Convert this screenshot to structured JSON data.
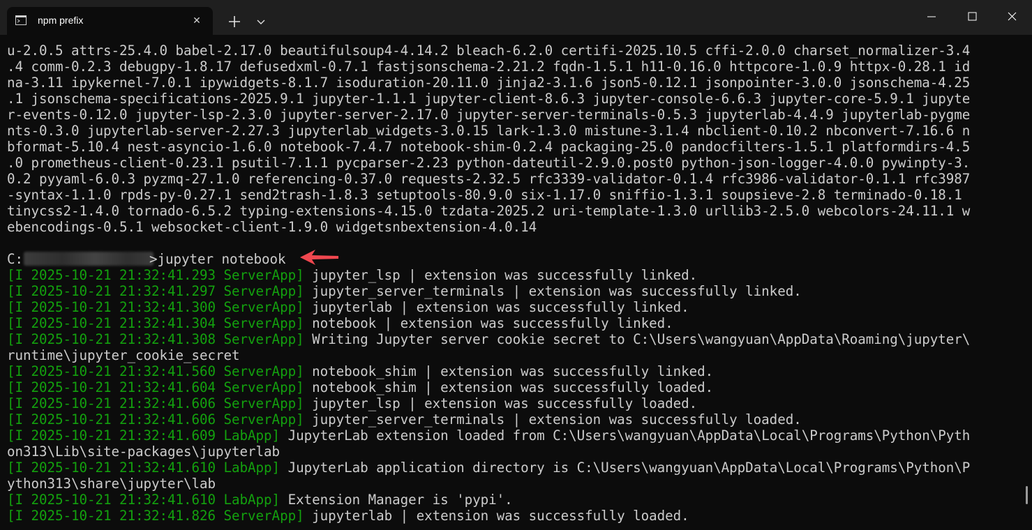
{
  "tab": {
    "title": "npm prefix"
  },
  "terminal": {
    "pip_output_lines": [
      "u-2.0.5 attrs-25.4.0 babel-2.17.0 beautifulsoup4-4.14.2 bleach-6.2.0 certifi-2025.10.5 cffi-2.0.0 charset_normalizer-3.4",
      ".4 comm-0.2.3 debugpy-1.8.17 defusedxml-0.7.1 fastjsonschema-2.21.2 fqdn-1.5.1 h11-0.16.0 httpcore-1.0.9 httpx-0.28.1 id",
      "na-3.11 ipykernel-7.0.1 ipywidgets-8.1.7 isoduration-20.11.0 jinja2-3.1.6 json5-0.12.1 jsonpointer-3.0.0 jsonschema-4.25",
      ".1 jsonschema-specifications-2025.9.1 jupyter-1.1.1 jupyter-client-8.6.3 jupyter-console-6.6.3 jupyter-core-5.9.1 jupyte",
      "r-events-0.12.0 jupyter-lsp-2.3.0 jupyter-server-2.17.0 jupyter-server-terminals-0.5.3 jupyterlab-4.4.9 jupyterlab-pygme",
      "nts-0.3.0 jupyterlab-server-2.27.3 jupyterlab_widgets-3.0.15 lark-1.3.0 mistune-3.1.4 nbclient-0.10.2 nbconvert-7.16.6 n",
      "bformat-5.10.4 nest-asyncio-1.6.0 notebook-7.4.7 notebook-shim-0.2.4 packaging-25.0 pandocfilters-1.5.1 platformdirs-4.5",
      ".0 prometheus-client-0.23.1 psutil-7.1.1 pycparser-2.23 python-dateutil-2.9.0.post0 python-json-logger-4.0.0 pywinpty-3.",
      "0.2 pyyaml-6.0.3 pyzmq-27.1.0 referencing-0.37.0 requests-2.32.5 rfc3339-validator-0.1.4 rfc3986-validator-0.1.1 rfc3987",
      "-syntax-1.1.0 rpds-py-0.27.1 send2trash-1.8.3 setuptools-80.9.0 six-1.17.0 sniffio-1.3.1 soupsieve-2.8 terminado-0.18.1",
      "tinycss2-1.4.0 tornado-6.5.2 typing-extensions-4.15.0 tzdata-2025.2 uri-template-1.3.0 urllib3-2.5.0 webcolors-24.11.1 w",
      "ebencodings-0.5.1 websocket-client-1.9.0 widgetsnbextension-4.0.14"
    ],
    "prompt": {
      "drive": "C:",
      "symbol": ">",
      "command": "jupyter notebook"
    },
    "log_lines": [
      {
        "prefix": "[I 2025-10-21 21:32:41.293 ServerApp]",
        "text": " jupyter_lsp | extension was successfully linked."
      },
      {
        "prefix": "[I 2025-10-21 21:32:41.297 ServerApp]",
        "text": " jupyter_server_terminals | extension was successfully linked."
      },
      {
        "prefix": "[I 2025-10-21 21:32:41.300 ServerApp]",
        "text": " jupyterlab | extension was successfully linked."
      },
      {
        "prefix": "[I 2025-10-21 21:32:41.304 ServerApp]",
        "text": " notebook | extension was successfully linked."
      },
      {
        "prefix": "[I 2025-10-21 21:32:41.308 ServerApp]",
        "text": " Writing Jupyter server cookie secret to C:\\Users\\wangyuan\\AppData\\Roaming\\jupyter\\"
      },
      {
        "prefix": "",
        "text": "runtime\\jupyter_cookie_secret"
      },
      {
        "prefix": "[I 2025-10-21 21:32:41.560 ServerApp]",
        "text": " notebook_shim | extension was successfully linked."
      },
      {
        "prefix": "[I 2025-10-21 21:32:41.604 ServerApp]",
        "text": " notebook_shim | extension was successfully loaded."
      },
      {
        "prefix": "[I 2025-10-21 21:32:41.606 ServerApp]",
        "text": " jupyter_lsp | extension was successfully loaded."
      },
      {
        "prefix": "[I 2025-10-21 21:32:41.606 ServerApp]",
        "text": " jupyter_server_terminals | extension was successfully loaded."
      },
      {
        "prefix": "[I 2025-10-21 21:32:41.609 LabApp]",
        "text": " JupyterLab extension loaded from C:\\Users\\wangyuan\\AppData\\Local\\Programs\\Python\\Pyth"
      },
      {
        "prefix": "",
        "text": "on313\\Lib\\site-packages\\jupyterlab"
      },
      {
        "prefix": "[I 2025-10-21 21:32:41.610 LabApp]",
        "text": " JupyterLab application directory is C:\\Users\\wangyuan\\AppData\\Local\\Programs\\Python\\P"
      },
      {
        "prefix": "",
        "text": "ython313\\share\\jupyter\\lab"
      },
      {
        "prefix": "[I 2025-10-21 21:32:41.610 LabApp]",
        "text": " Extension Manager is 'pypi'."
      },
      {
        "prefix": "[I 2025-10-21 21:32:41.826 ServerApp]",
        "text": " jupyterlab | extension was successfully loaded."
      }
    ]
  },
  "colors": {
    "background": "#0c0c0c",
    "titlebar": "#1f1f1f",
    "text": "#cccccc",
    "log_prefix": "#13a10e",
    "arrow": "#f0474f"
  },
  "icons": {
    "tab_icon": "terminal-icon",
    "tab_close": "close-icon",
    "new_tab": "plus-icon",
    "dropdown": "chevron-down-icon",
    "minimize": "minimize-icon",
    "maximize": "maximize-icon",
    "close": "close-icon",
    "annotation": "red-arrow-icon"
  }
}
